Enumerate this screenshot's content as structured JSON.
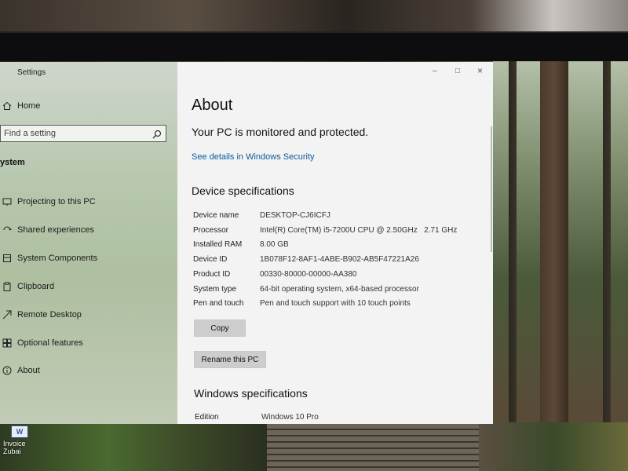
{
  "window": {
    "title": "Settings",
    "controls": {
      "minimize": "–",
      "maximize": "□",
      "close": "×"
    }
  },
  "sidebar": {
    "home_label": "Home",
    "search_placeholder": "Find a setting",
    "section_label": "ystem",
    "items": [
      {
        "label": "Projecting to this PC",
        "icon": "projector-icon"
      },
      {
        "label": "Shared experiences",
        "icon": "shared-experiences-icon"
      },
      {
        "label": "System Components",
        "icon": "system-components-icon"
      },
      {
        "label": "Clipboard",
        "icon": "clipboard-icon"
      },
      {
        "label": "Remote Desktop",
        "icon": "remote-desktop-icon"
      },
      {
        "label": "Optional features",
        "icon": "optional-features-icon"
      },
      {
        "label": "About",
        "icon": "info-icon"
      }
    ]
  },
  "main": {
    "title": "About",
    "protection_status": "Your PC is monitored and protected.",
    "security_link": "See details in Windows Security",
    "device_specs_heading": "Device specifications",
    "device_specs": [
      {
        "key": "Device name",
        "value": "DESKTOP-CJ6ICFJ"
      },
      {
        "key": "Processor",
        "value": "Intel(R) Core(TM) i5-7200U CPU @ 2.50GHz   2.71 GHz"
      },
      {
        "key": "Installed RAM",
        "value": "8.00 GB"
      },
      {
        "key": "Device ID",
        "value": "1B078F12-8AF1-4ABE-B902-AB5F47221A26"
      },
      {
        "key": "Product ID",
        "value": "00330-80000-00000-AA380"
      },
      {
        "key": "System type",
        "value": "64-bit operating system, x64-based processor"
      },
      {
        "key": "Pen and touch",
        "value": "Pen and touch support with 10 touch points"
      }
    ],
    "copy_button": "Copy",
    "rename_button": "Rename this PC",
    "windows_specs_heading": "Windows specifications",
    "windows_specs": [
      {
        "key": "Edition",
        "value": "Windows 10 Pro"
      }
    ]
  },
  "desktop": {
    "icon_label_1": "Invoice",
    "icon_label_2": "Zubai",
    "icon_glyph": "W"
  }
}
